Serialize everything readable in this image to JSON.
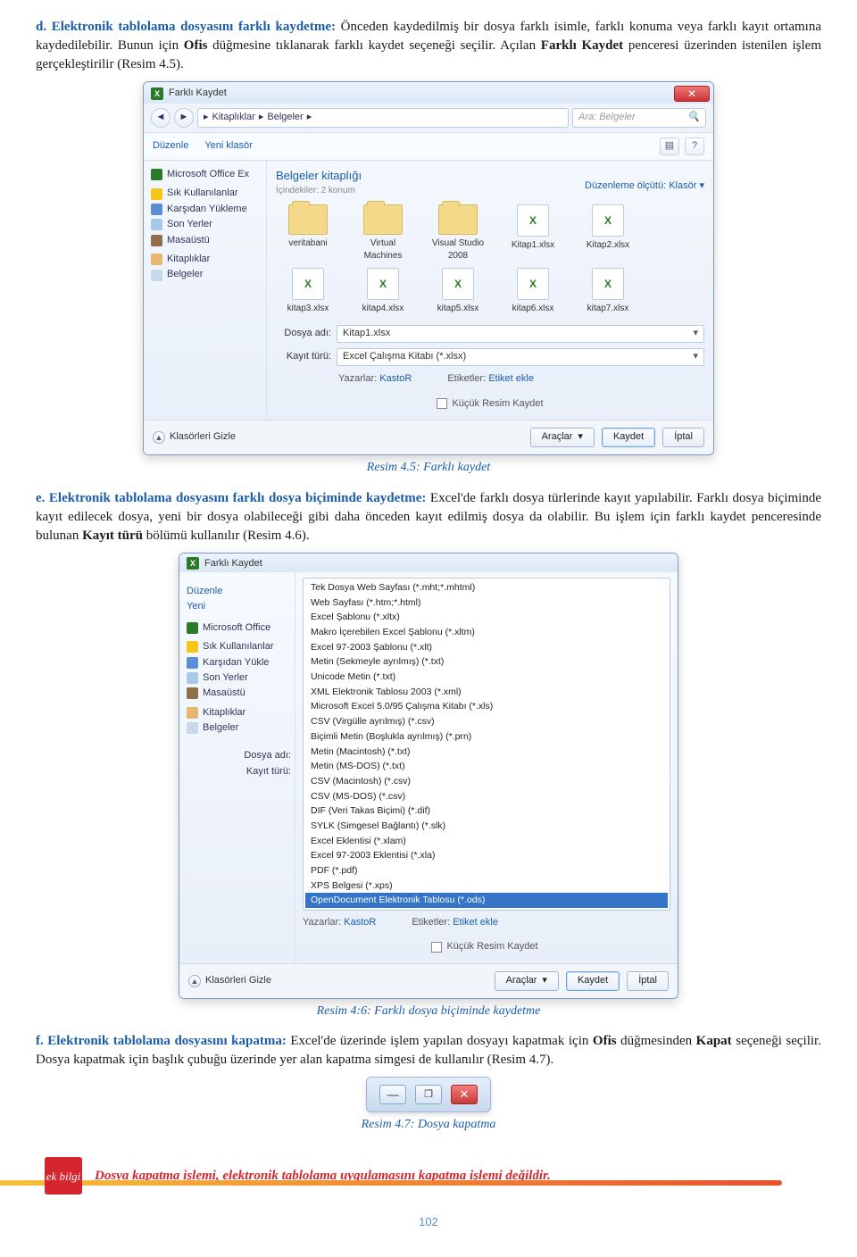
{
  "para_d": {
    "lead": "d. Elektronik tablolama dosyasını farklı kaydetme:",
    "text": " Önceden kaydedilmiş bir dosya farklı isimle, farklı konuma veya farklı kayıt ortamına kaydedilebilir. Bunun için ",
    "bold1": "Ofis",
    "text2": " düğmesine tıklanarak farklı kaydet seçeneği seçilir. Açılan ",
    "bold2": "Farklı Kaydet",
    "text3": " penceresi üzerinden istenilen işlem gerçekleştirilir (Resim 4.5)."
  },
  "fig1": {
    "title": "Farklı Kaydet",
    "bc_items": [
      "Kitaplıklar",
      "Belgeler"
    ],
    "search_ph": "Ara: Belgeler",
    "toolbar": {
      "duzenle": "Düzenle",
      "yeniklasor": "Yeni klasör"
    },
    "side": {
      "office": "Microsoft Office Ex",
      "fav": "Sık Kullanılanlar",
      "ky": "Karşıdan Yükleme",
      "sy": "Son Yerler",
      "mas": "Masaüstü",
      "lib": "Kitaplıklar",
      "bel": "Belgeler"
    },
    "lib_title": "Belgeler kitaplığı",
    "lib_sub": "İçindekiler: 2 konum",
    "arrange_label": "Düzenleme ölçütü:",
    "arrange_val": "Klasör",
    "folders": [
      "veritabani",
      "Virtual Machines",
      "Visual Studio 2008"
    ],
    "xlsfiles": [
      "Kitap1.xlsx",
      "Kitap2.xlsx",
      "kitap3.xlsx",
      "kitap4.xlsx",
      "kitap5.xlsx",
      "kitap6.xlsx",
      "kitap7.xlsx"
    ],
    "fname_label": "Dosya adı:",
    "fname_val": "Kitap1.xlsx",
    "ftype_label": "Kayıt türü:",
    "ftype_val": "Excel Çalışma Kitabı (*.xlsx)",
    "authors_label": "Yazarlar:",
    "authors_val": "KastoR",
    "tags_label": "Etiketler:",
    "tags_val": "Etiket ekle",
    "thumb": "Küçük Resim Kaydet",
    "hide": "Klasörleri Gizle",
    "tools": "Araçlar",
    "save": "Kaydet",
    "cancel": "İptal",
    "caption": "Resim 4.5: Farklı kaydet"
  },
  "para_e": {
    "lead": "e. Elektronik tablolama dosyasını farklı dosya biçiminde kaydetme:",
    "text": " Excel'de farklı dosya türlerinde kayıt yapılabilir. Farklı dosya biçiminde kayıt edilecek dosya, yeni bir dosya olabileceği gibi daha önceden kayıt edilmiş dosya da olabilir. Bu işlem için farklı kaydet penceresinde bulunan ",
    "bold": "Kayıt türü",
    "text2": " bölümü kullanılır (Resim 4.6)."
  },
  "fig2": {
    "title": "Farklı Kaydet",
    "types": [
      "Tek Dosya Web Sayfası (*.mht;*.mhtml)",
      "Web Sayfası (*.htm;*.html)",
      "Excel Şablonu (*.xltx)",
      "Makro İçerebilen Excel Şablonu (*.xltm)",
      "Excel 97-2003 Şablonu (*.xlt)",
      "Metin (Sekmeyle ayrılmış) (*.txt)",
      "Unicode Metin (*.txt)",
      "XML Elektronik Tablosu 2003 (*.xml)",
      "Microsoft Excel 5.0/95 Çalışma Kitabı (*.xls)",
      "CSV (Virgülle ayrılmış) (*.csv)",
      "Biçimli Metin (Boşlukla ayrılmış) (*.prn)",
      "Metin (Macintosh) (*.txt)",
      "Metin (MS-DOS) (*.txt)",
      "CSV (Macintosh) (*.csv)",
      "CSV (MS-DOS) (*.csv)",
      "DIF (Veri Takas Biçimi) (*.dif)",
      "SYLK (Simgesel Bağlantı) (*.slk)",
      "Excel Eklentisi (*.xlam)",
      "Excel 97-2003 Eklentisi (*.xla)",
      "PDF (*.pdf)",
      "XPS Belgesi (*.xps)",
      "OpenDocument Elektronik Tablosu (*.ods)"
    ],
    "selected_index": 21,
    "fname_label": "Dosya adı:",
    "ftype_label": "Kayıt türü:",
    "authors_label": "Yazarlar:",
    "authors_val": "KastoR",
    "tags_label": "Etiketler:",
    "tags_val": "Etiket ekle",
    "thumb": "Küçük Resim Kaydet",
    "hide": "Klasörleri Gizle",
    "tools": "Araçlar",
    "save": "Kaydet",
    "cancel": "İptal",
    "toolbar": {
      "duzenle": "Düzenle",
      "yeni": "Yeni"
    },
    "side": {
      "office": "Microsoft Office",
      "fav": "Sık Kullanılanlar",
      "ky": "Karşıdan Yükle",
      "sy": "Son Yerler",
      "mas": "Masaüstü",
      "lib": "Kitaplıklar",
      "bel": "Belgeler"
    },
    "caption": "Resim 4:6: Farklı dosya biçiminde kaydetme"
  },
  "para_f": {
    "lead": "f. Elektronik tablolama dosyasını kapatma:",
    "text": " Excel'de üzerinde işlem yapılan dosyayı kapatmak için ",
    "bold1": "Ofis",
    "text2": " düğmesinden ",
    "bold2": "Kapat",
    "text3": " seçeneği seçilir. Dosya kapatmak için başlık çubuğu üzerinde yer alan kapatma simgesi de kullanılır (Resim 4.7)."
  },
  "fig3": {
    "caption": "Resim 4.7: Dosya kapatma"
  },
  "ekbilgi": {
    "tag": "ek bilgi",
    "text": "Dosya kapatma işlemi, elektronik tablolama uygulamasını kapatma işlemi değildir."
  },
  "pagenum": "102"
}
